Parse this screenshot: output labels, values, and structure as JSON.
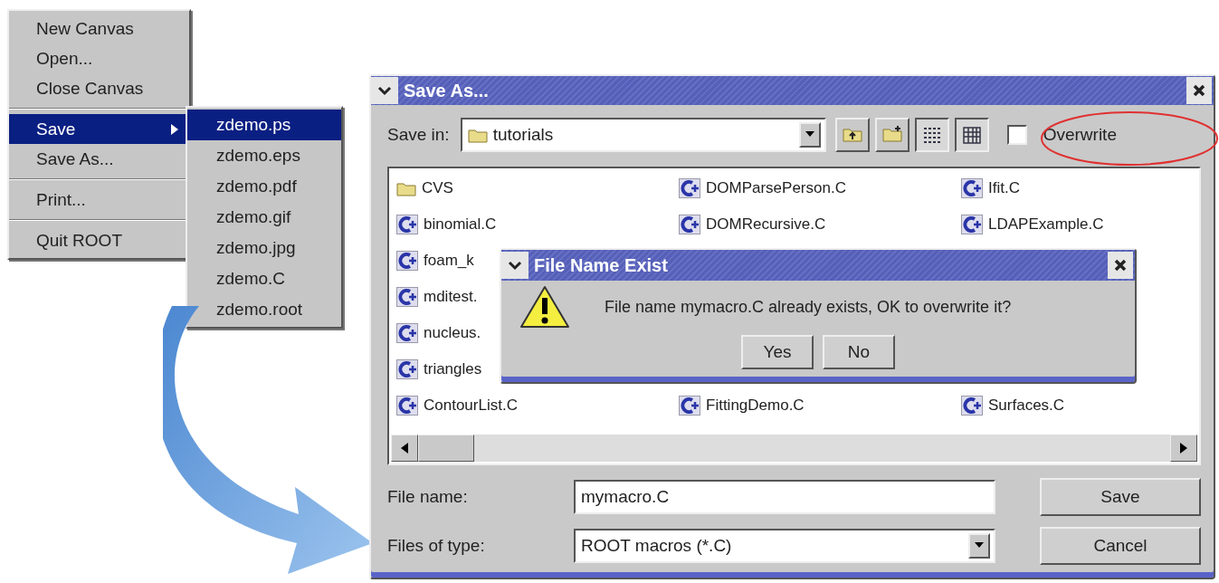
{
  "file_menu": {
    "items": [
      {
        "kind": "item",
        "label": "New Canvas",
        "selected": false
      },
      {
        "kind": "item",
        "label": "Open...",
        "selected": false
      },
      {
        "kind": "item",
        "label": "Close Canvas",
        "selected": false
      },
      {
        "kind": "separator"
      },
      {
        "kind": "submenu",
        "label": "Save",
        "selected": true
      },
      {
        "kind": "item",
        "label": "Save As...",
        "selected": false
      },
      {
        "kind": "separator"
      },
      {
        "kind": "item",
        "label": "Print...",
        "selected": false
      },
      {
        "kind": "separator"
      },
      {
        "kind": "item",
        "label": "Quit ROOT",
        "selected": false
      }
    ]
  },
  "save_submenu": {
    "items": [
      {
        "label": "zdemo.ps",
        "selected": true
      },
      {
        "label": "zdemo.eps",
        "selected": false
      },
      {
        "label": "zdemo.pdf",
        "selected": false
      },
      {
        "label": "zdemo.gif",
        "selected": false
      },
      {
        "label": "zdemo.jpg",
        "selected": false
      },
      {
        "label": "zdemo.C",
        "selected": false
      },
      {
        "label": "zdemo.root",
        "selected": false
      }
    ]
  },
  "save_as_dialog": {
    "title": "Save As...",
    "save_in_label": "Save in:",
    "folder": "tutorials",
    "overwrite": {
      "label": "Overwrite",
      "checked": false
    },
    "file_rows": [
      {
        "cells": [
          {
            "kind": "folder",
            "name": "CVS"
          },
          {
            "kind": "macro",
            "name": "DOMParsePerson.C"
          },
          {
            "kind": "macro",
            "name": "Ifit.C"
          }
        ]
      },
      {
        "cells": [
          {
            "kind": "macro",
            "name": "binomial.C"
          },
          {
            "kind": "macro",
            "name": "DOMRecursive.C"
          },
          {
            "kind": "macro",
            "name": "LDAPExample.C"
          }
        ]
      },
      {
        "cells": [
          {
            "kind": "macro",
            "name": "foam_k"
          }
        ]
      },
      {
        "cells": [
          {
            "kind": "macro",
            "name": "mditest."
          }
        ]
      },
      {
        "cells": [
          {
            "kind": "macro",
            "name": "nucleus."
          }
        ]
      },
      {
        "cells": [
          {
            "kind": "macro",
            "name": "triangles"
          }
        ]
      },
      {
        "cells": [
          {
            "kind": "macro",
            "name": "ContourList.C"
          },
          {
            "kind": "macro",
            "name": "FittingDemo.C"
          },
          {
            "kind": "macro",
            "name": "Surfaces.C"
          }
        ]
      }
    ],
    "file_name_label": "File name:",
    "file_name": "mymacro.C",
    "file_type_label": "Files of type:",
    "file_type": "ROOT macros (*.C)",
    "buttons": [
      "Save",
      "Cancel"
    ]
  },
  "confirm_dialog": {
    "title": "File Name Exist",
    "message": "File name mymacro.C already exists, OK to overwrite it?",
    "buttons": [
      "Yes",
      "No"
    ]
  }
}
